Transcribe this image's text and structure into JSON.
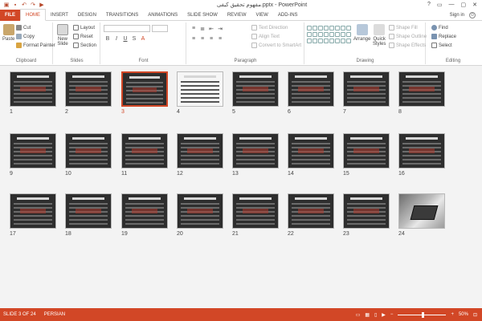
{
  "titlebar": {
    "title": "مفهوم تحقیق کیفی.pptx - PowerPoint",
    "qat_icons": [
      "save-icon",
      "undo-icon",
      "redo-icon",
      "start-from-beginning-icon"
    ],
    "controls": [
      "?",
      "▭",
      "—",
      "▢",
      "✕"
    ]
  },
  "tabs": [
    "FILE",
    "HOME",
    "INSERT",
    "DESIGN",
    "TRANSITIONS",
    "ANIMATIONS",
    "SLIDE SHOW",
    "REVIEW",
    "VIEW",
    "ADD-INS"
  ],
  "active_tab": "HOME",
  "signin": "Sign in",
  "ribbon": {
    "clipboard": {
      "label": "Clipboard",
      "paste": "Paste",
      "cut": "Cut",
      "copy": "Copy",
      "format_painter": "Format Painter"
    },
    "slides": {
      "label": "Slides",
      "new_slide": "New",
      "new_slide_2": "Slide",
      "layout": "Layout",
      "reset": "Reset",
      "section": "Section"
    },
    "font": {
      "label": "Font"
    },
    "paragraph": {
      "label": "Paragraph",
      "text_direction": "Text Direction",
      "align_text": "Align Text",
      "convert_smartart": "Convert to SmartArt"
    },
    "drawing": {
      "label": "Drawing",
      "arrange": "Arrange",
      "quick_styles": "Quick",
      "quick_styles_2": "Styles",
      "shape_fill": "Shape Fill",
      "shape_outline": "Shape Outline",
      "shape_effects": "Shape Effects"
    },
    "editing": {
      "label": "Editing",
      "find": "Find",
      "replace": "Replace",
      "select": "Select"
    }
  },
  "slides": [
    {
      "num": "1",
      "style": "dark",
      "selected": false
    },
    {
      "num": "2",
      "style": "dark",
      "selected": false
    },
    {
      "num": "3",
      "style": "dark",
      "selected": true
    },
    {
      "num": "4",
      "style": "white",
      "selected": false
    },
    {
      "num": "5",
      "style": "dark",
      "selected": false
    },
    {
      "num": "6",
      "style": "dark",
      "selected": false
    },
    {
      "num": "7",
      "style": "dark",
      "selected": false
    },
    {
      "num": "8",
      "style": "dark",
      "selected": false
    },
    {
      "num": "9",
      "style": "dark",
      "selected": false
    },
    {
      "num": "10",
      "style": "dark",
      "selected": false
    },
    {
      "num": "11",
      "style": "dark",
      "selected": false
    },
    {
      "num": "12",
      "style": "dark",
      "selected": false
    },
    {
      "num": "13",
      "style": "dark",
      "selected": false
    },
    {
      "num": "14",
      "style": "dark",
      "selected": false
    },
    {
      "num": "15",
      "style": "dark",
      "selected": false
    },
    {
      "num": "16",
      "style": "dark",
      "selected": false
    },
    {
      "num": "17",
      "style": "dark",
      "selected": false
    },
    {
      "num": "18",
      "style": "dark",
      "selected": false
    },
    {
      "num": "19",
      "style": "dark",
      "selected": false
    },
    {
      "num": "20",
      "style": "dark",
      "selected": false
    },
    {
      "num": "21",
      "style": "dark",
      "selected": false
    },
    {
      "num": "22",
      "style": "dark",
      "selected": false
    },
    {
      "num": "23",
      "style": "dark",
      "selected": false
    },
    {
      "num": "24",
      "style": "photo",
      "selected": false
    }
  ],
  "status": {
    "slide_info": "SLIDE 3 OF 24",
    "language": "PERSIAN",
    "zoom": "50%"
  },
  "colors": {
    "accent": "#d24726",
    "slide_dark": "#2e2e2e",
    "selection": "#d24726"
  }
}
